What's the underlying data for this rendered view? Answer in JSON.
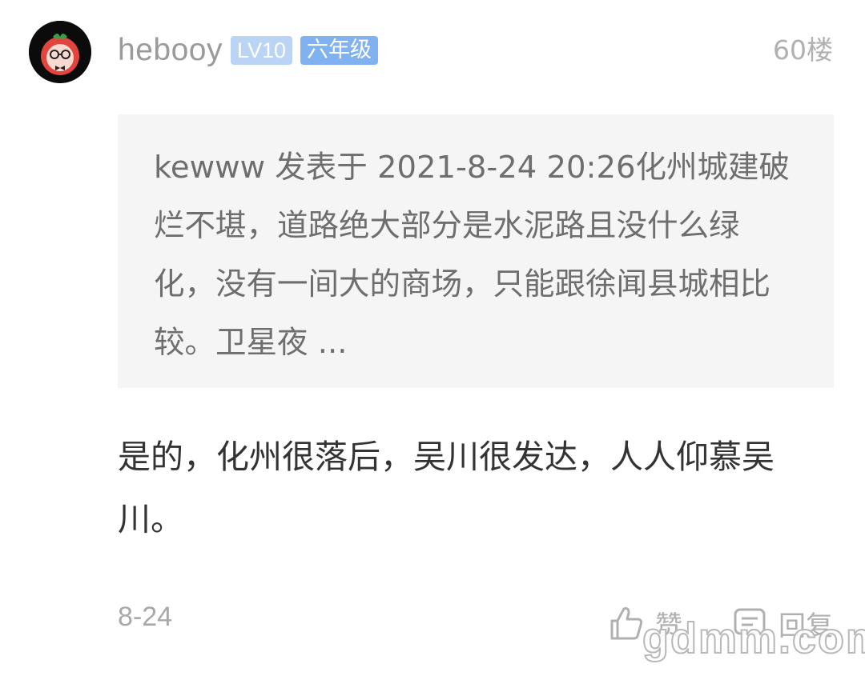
{
  "post": {
    "username": "hebooy",
    "level_badge": "LV10",
    "grade_badge": "六年级",
    "floor": "60楼",
    "quote": "kewww 发表于 2021-8-24 20:26化州城建破烂不堪，道路绝大部分是水泥路且没什么绿化，没有一间大的商场，只能跟徐闻县城相比较。卫星夜 ...",
    "reply": "是的，化州很落后，吴川很发达，人人仰慕吴川。",
    "date": "8-24",
    "like_label": "赞",
    "reply_label": "回复"
  },
  "watermark": "gdmm.com",
  "icons": {
    "like": "thumbs-up-icon",
    "reply": "comment-icon"
  },
  "colors": {
    "level_badge": "#b9d4f5",
    "grade_badge": "#7fb2ee",
    "quote_background": "#f5f5f5"
  }
}
